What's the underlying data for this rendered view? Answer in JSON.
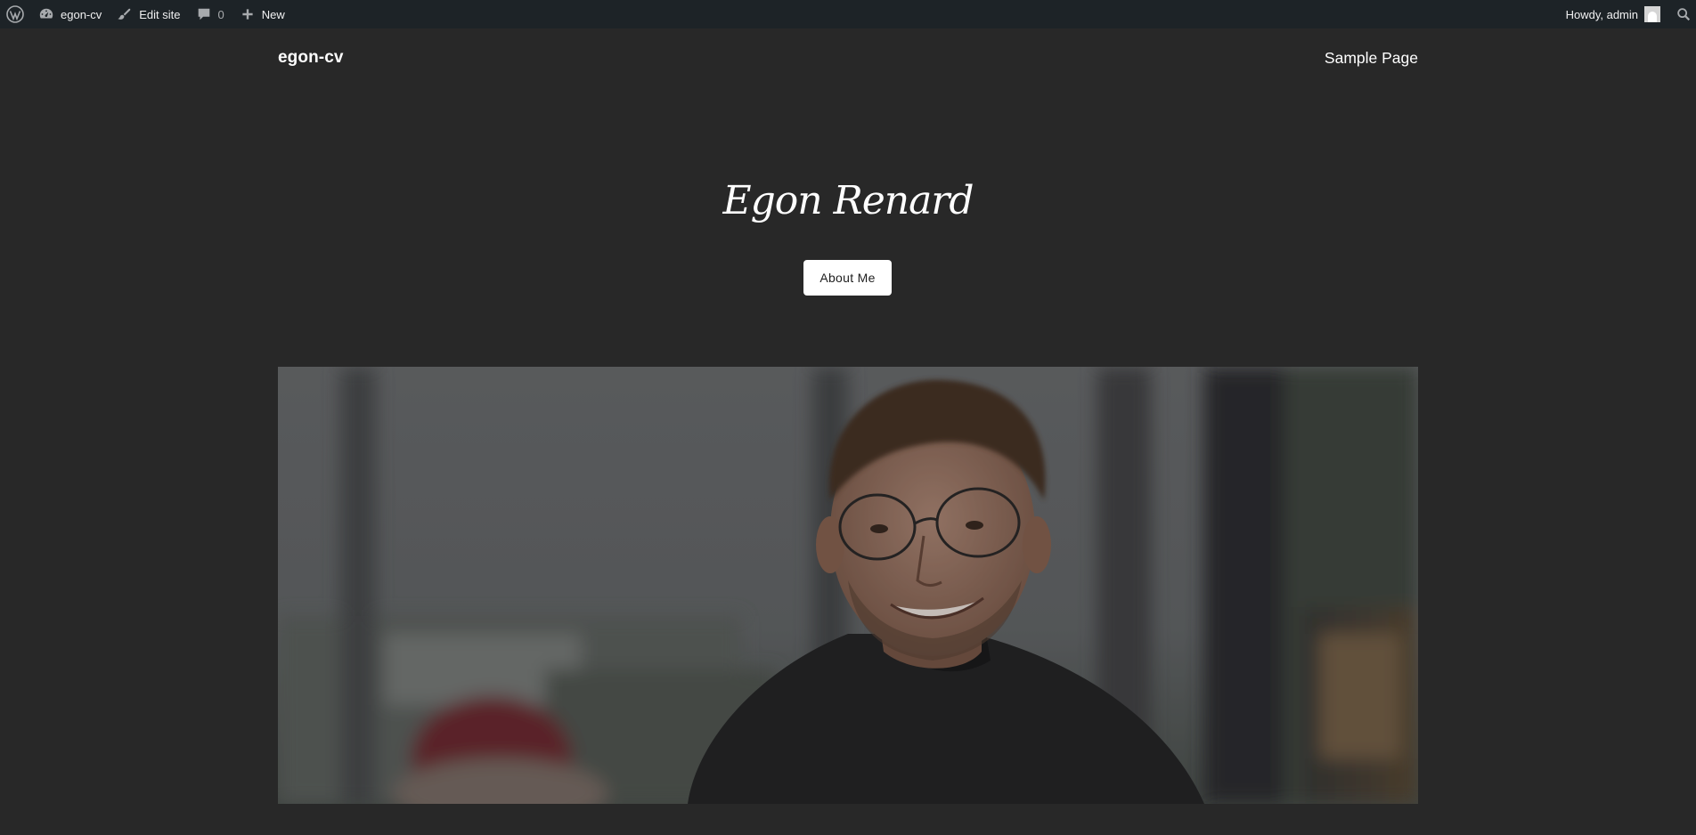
{
  "adminbar": {
    "site_name": "egon-cv",
    "edit_site": "Edit site",
    "comments_count": "0",
    "new_label": "New",
    "howdy": "Howdy, admin"
  },
  "header": {
    "site_title": "egon-cv",
    "nav_items": [
      "Sample Page"
    ]
  },
  "hero": {
    "title": "Egon Renard",
    "button_label": "About Me"
  },
  "icons": {
    "wp_logo": "wordpress-logo-icon",
    "dashboard": "dashboard-icon",
    "edit": "brush-icon",
    "comments": "comment-bubble-icon",
    "new": "plus-icon",
    "search": "search-icon"
  },
  "colors": {
    "page_bg": "#282828",
    "adminbar_bg": "#1d2327",
    "button_bg": "#ffffff",
    "text": "#ffffff"
  }
}
